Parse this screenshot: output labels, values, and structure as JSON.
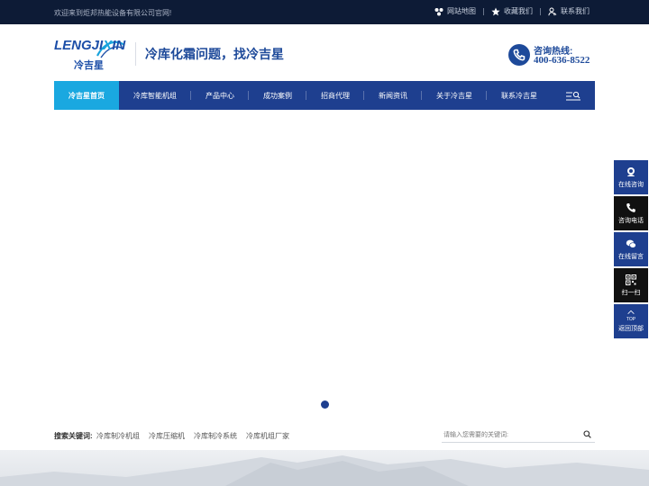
{
  "topbar": {
    "welcome": "欢迎来到炬邦热能设备有限公司官网!",
    "links": [
      {
        "label": "网站地图",
        "icon": "sitemap-icon"
      },
      {
        "label": "收藏我们",
        "icon": "star-icon"
      },
      {
        "label": "联系我们",
        "icon": "contact-icon"
      }
    ]
  },
  "header": {
    "logo_en_1": "LENGJI",
    "logo_en_x": "X",
    "logo_en_2": "IN",
    "logo_cn": "冷吉星",
    "slogan": "冷库化霜问题，找冷吉星",
    "hotline_label": "咨询热线:",
    "hotline_number": "400-636-8522"
  },
  "nav": {
    "items": [
      {
        "label": "冷吉星首页",
        "active": true
      },
      {
        "label": "冷库智能机组"
      },
      {
        "label": "产品中心"
      },
      {
        "label": "成功案例"
      },
      {
        "label": "招商代理"
      },
      {
        "label": "新闻资讯"
      },
      {
        "label": "关于冷吉星"
      },
      {
        "label": "联系冷吉星"
      }
    ]
  },
  "keywords": {
    "title": "搜索关键词:",
    "items": [
      "冷库制冷机组",
      "冷库压缩机",
      "冷库制冷系统",
      "冷库机组厂家"
    ]
  },
  "search": {
    "placeholder": "请输入您需要的关键词:"
  },
  "sidebar": {
    "items": [
      {
        "label": "在线咨询",
        "icon": "chat-person-icon",
        "style": "blue"
      },
      {
        "label": "咨询电话",
        "icon": "phone-icon",
        "style": "black"
      },
      {
        "label": "在线留言",
        "icon": "message-icon",
        "style": "blue"
      },
      {
        "label": "扫一扫",
        "icon": "qrcode-icon",
        "style": "black"
      },
      {
        "label": "返回顶部",
        "icon": "top-arrow-icon",
        "style": "blue",
        "sub": "TOP"
      }
    ]
  },
  "colors": {
    "topbar_bg": "#0d1b36",
    "nav_bg": "#1e3f8f",
    "nav_active": "#1aa8e0",
    "brand_blue": "#1e4a9a"
  }
}
